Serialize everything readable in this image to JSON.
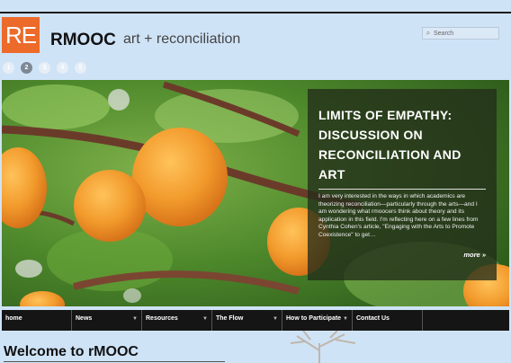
{
  "header": {
    "logo_text": "RE",
    "title": "RMOOC",
    "tagline": "art + reconciliation",
    "search_placeholder": "Search"
  },
  "colors": {
    "logo": "#ec6a2a",
    "nav_bg": "#151515",
    "page_bg": "#cfe3f7"
  },
  "slider": {
    "pages": [
      "1",
      "2",
      "3",
      "4",
      "5"
    ],
    "active_index": 1
  },
  "feature": {
    "title": "LIMITS OF EMPATHY: DISCUSSION ON RECONCILIATION AND ART",
    "excerpt": "I am very interested in the ways in which academics are theorizing reconciliation—particularly through the arts—and I am wondering what rmoocers think about theory and its application in this field. I'm reflecting here on a few lines from Cynthia Cohen's article, \"Engaging with the Arts to Promote Coexistence\" to get…",
    "more_label": "more »"
  },
  "nav": {
    "items": [
      {
        "label": "home",
        "dropdown": false
      },
      {
        "label": "News",
        "dropdown": true
      },
      {
        "label": "Resources",
        "dropdown": true
      },
      {
        "label": "The Flow",
        "dropdown": true
      },
      {
        "label": "How to Participate",
        "dropdown": true
      },
      {
        "label": "Contact Us",
        "dropdown": false
      }
    ]
  },
  "main": {
    "heading": "Welcome to rMOOC"
  }
}
